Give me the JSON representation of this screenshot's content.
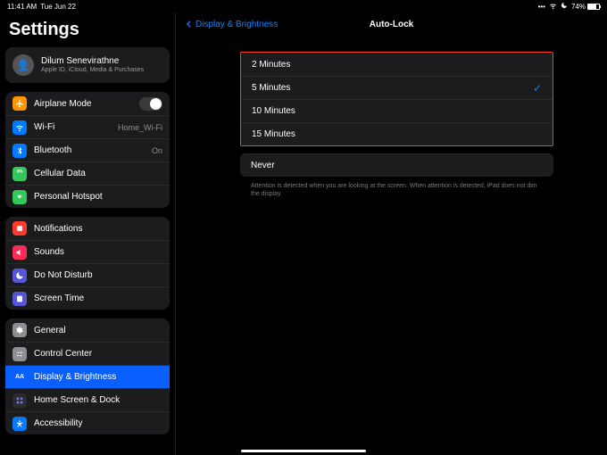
{
  "status": {
    "time": "11:41 AM",
    "date": "Tue Jun 22",
    "battery_pct": "74%"
  },
  "sidebar": {
    "title": "Settings",
    "profile": {
      "name": "Dilum Senevirathne",
      "sub": "Apple ID, iCloud, Media & Purchases"
    },
    "g1": {
      "airplane": "Airplane Mode",
      "wifi": "Wi-Fi",
      "wifi_val": "Home_Wi-Fi",
      "bt": "Bluetooth",
      "bt_val": "On",
      "cell": "Cellular Data",
      "hotspot": "Personal Hotspot"
    },
    "g2": {
      "notif": "Notifications",
      "sounds": "Sounds",
      "dnd": "Do Not Disturb",
      "screentime": "Screen Time"
    },
    "g3": {
      "general": "General",
      "cc": "Control Center",
      "display": "Display & Brightness",
      "home": "Home Screen & Dock",
      "access": "Accessibility"
    }
  },
  "main": {
    "back": "Display & Brightness",
    "title": "Auto-Lock",
    "options": {
      "o0": "2 Minutes",
      "o1": "5 Minutes",
      "o2": "10 Minutes",
      "o3": "15 Minutes"
    },
    "never": "Never",
    "note": "Attention is detected when you are looking at the screen. When attention is detected, iPad does not dim the display."
  }
}
